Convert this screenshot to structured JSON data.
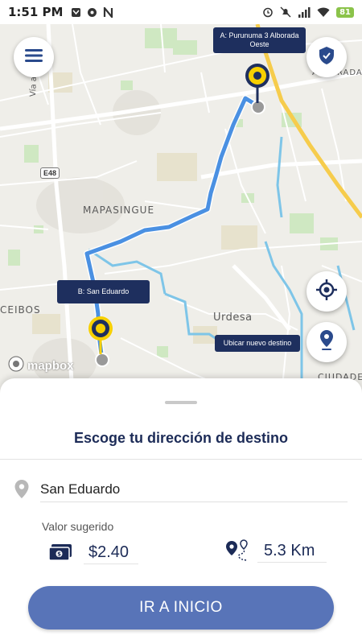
{
  "status_bar": {
    "time": "1:51 PM",
    "battery": "81",
    "icons_left": [
      "message-icon",
      "ball-icon",
      "n-icon"
    ],
    "icons_right": [
      "alarm-icon",
      "mute-icon",
      "signal-icon",
      "wifi-icon"
    ]
  },
  "map": {
    "labels": {
      "mapasingue": "MAPASINGUE",
      "urdesa": "Urdesa",
      "ceibos": "CEIBOS",
      "via": "Vía a Da",
      "alborada": "ALBORADA",
      "ciudadela": "CIUDADE"
    },
    "road_shield": "E48",
    "origin_tooltip": "A: Purunuma 3 Alborada Oeste",
    "destination_tooltip": "B: San Eduardo",
    "locate_tooltip": "Ubicar nuevo destino",
    "attribution": "mapbox",
    "colors": {
      "route": "#4a90e2",
      "marker": "#f7d000",
      "accent": "#1e2f5e"
    }
  },
  "sheet": {
    "title": "Escoge tu dirección de destino",
    "destination_value": "San Eduardo",
    "price_label": "Valor sugerido",
    "price_value": "$2.40",
    "distance_value": "5.3 Km",
    "cta_label": "IR A INICIO"
  }
}
